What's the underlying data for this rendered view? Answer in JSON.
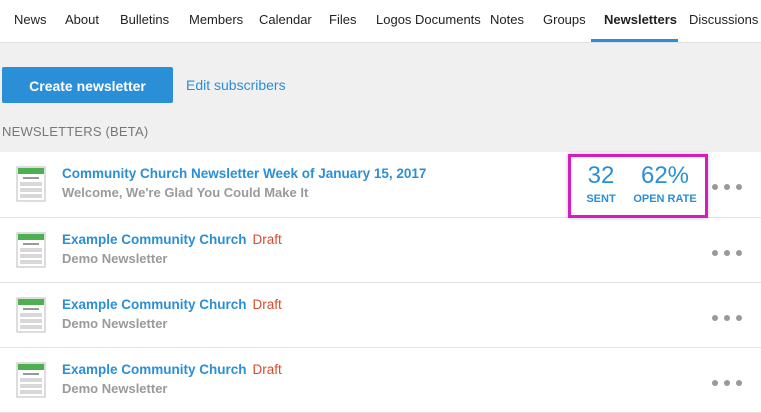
{
  "nav": {
    "items": [
      {
        "label": "News"
      },
      {
        "label": "About"
      },
      {
        "label": "Bulletins"
      },
      {
        "label": "Members"
      },
      {
        "label": "Calendar"
      },
      {
        "label": "Files"
      },
      {
        "label": "Logos Documents"
      },
      {
        "label": "Notes"
      },
      {
        "label": "Groups"
      },
      {
        "label": "Newsletters"
      },
      {
        "label": "Discussions"
      }
    ],
    "active": "Newsletters"
  },
  "actions": {
    "create_label": "Create newsletter",
    "edit_label": "Edit subscribers"
  },
  "section_title": "NEWSLETTERS (BETA)",
  "newsletters": [
    {
      "title": "Community Church Newsletter Week of January 15, 2017",
      "subtitle": "Welcome, We're Glad You Could Make It",
      "status": "",
      "sent": "32",
      "sent_label": "SENT",
      "open_rate": "62%",
      "open_rate_label": "OPEN RATE"
    },
    {
      "title": "Example Community Church",
      "subtitle": "Demo Newsletter",
      "status": "Draft"
    },
    {
      "title": "Example Community Church",
      "subtitle": "Demo Newsletter",
      "status": "Draft"
    },
    {
      "title": "Example Community Church",
      "subtitle": "Demo Newsletter",
      "status": "Draft"
    }
  ],
  "colors": {
    "accent": "#2a8fd6",
    "draft": "#d84b2a",
    "highlight": "#d61bc0"
  }
}
